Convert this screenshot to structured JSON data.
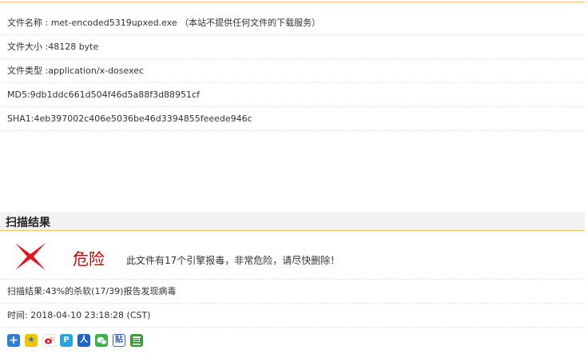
{
  "file_info": {
    "name": "文件名称 : met-encoded5319upxed.exe （本站不提供任何文件的下载服务）",
    "size": "文件大小 :48128 byte",
    "type": "文件类型 :application/x-dosexec",
    "md5": "MD5:9db1ddc661d504f46d5a88f3d88951cf",
    "sha1": "SHA1:4eb397002c406e5036be46d3394855feeede946c"
  },
  "scan": {
    "section_title": "扫描结果",
    "danger_label": "危险",
    "danger_message": "此文件有17个引擎报毒，非常危险，请尽快删除！",
    "result": "扫描结果:43%的杀软(17/39)报告发现病毒",
    "time": "时间: 2018-04-10 23:18:28 (CST)"
  },
  "colors": {
    "accent_line": "#f2c36a",
    "danger": "#cc0000",
    "x_mark": "#e8141c"
  },
  "share_icons": [
    "add-share-icon",
    "qzone-icon",
    "weibo-icon",
    "tencent-weibo-icon",
    "renren-icon",
    "wechat-icon",
    "tieba-icon",
    "douban-icon"
  ]
}
